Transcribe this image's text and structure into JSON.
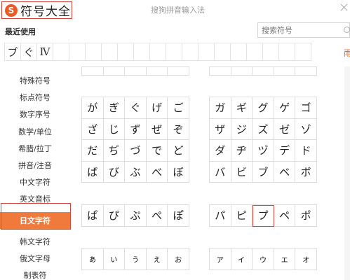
{
  "titlebar": {
    "logo_glyph": "S",
    "title": "符号大全",
    "caption": "搜狗拼音输入法"
  },
  "recent": {
    "label": "最近使用",
    "items": [
      "ブ",
      "ぐ",
      "Ⅳ",
      "",
      "",
      "",
      "",
      "",
      "",
      "",
      "",
      "",
      "",
      "",
      "",
      "",
      "",
      "",
      ""
    ],
    "more_label": "雨"
  },
  "search": {
    "placeholder": "搜索符号"
  },
  "sidebar": {
    "items": [
      {
        "label": "特殊符号"
      },
      {
        "label": "标点符号"
      },
      {
        "label": "数字序号"
      },
      {
        "label": "数学/单位"
      },
      {
        "label": "希腊/拉丁"
      },
      {
        "label": "拼音/注音"
      },
      {
        "label": "中文字符"
      },
      {
        "label": "英文音标"
      },
      {
        "label": "日文字符"
      },
      {
        "label": "韩文字符"
      },
      {
        "label": "俄文字母"
      },
      {
        "label": "制表符"
      }
    ],
    "active_index": 8
  },
  "grids": {
    "hira_voiced": [
      [
        "が",
        "ぎ",
        "ぐ",
        "げ",
        "ご"
      ],
      [
        "ざ",
        "じ",
        "ず",
        "ぜ",
        "ぞ"
      ],
      [
        "だ",
        "ぢ",
        "づ",
        "で",
        "ど"
      ],
      [
        "ば",
        "び",
        "ぶ",
        "べ",
        "ぼ"
      ]
    ],
    "kata_voiced": [
      [
        "ガ",
        "ギ",
        "グ",
        "ゲ",
        "ゴ"
      ],
      [
        "ザ",
        "ジ",
        "ズ",
        "ゼ",
        "ゾ"
      ],
      [
        "ダ",
        "ヂ",
        "ヅ",
        "デ",
        "ド"
      ],
      [
        "バ",
        "ビ",
        "ブ",
        "ベ",
        "ボ"
      ]
    ],
    "hira_semivoiced": [
      [
        "ぱ",
        "ぴ",
        "ぷ",
        "ぺ",
        "ぽ"
      ]
    ],
    "kata_semivoiced": [
      [
        "パ",
        "ピ",
        "プ",
        "ペ",
        "ポ"
      ]
    ],
    "hira_small": [
      [
        "ぁ",
        "ぃ",
        "ぅ",
        "ぇ",
        "ぉ"
      ]
    ],
    "kata_small": [
      [
        "ァ",
        "ィ",
        "ゥ",
        "ェ",
        "ォ"
      ]
    ],
    "selected": {
      "grid": "kata_semivoiced",
      "row": 0,
      "col": 2
    }
  },
  "colors": {
    "accent": "#ef7a3c",
    "highlight_border": "#d6453a",
    "logo": "#ee5a24"
  }
}
